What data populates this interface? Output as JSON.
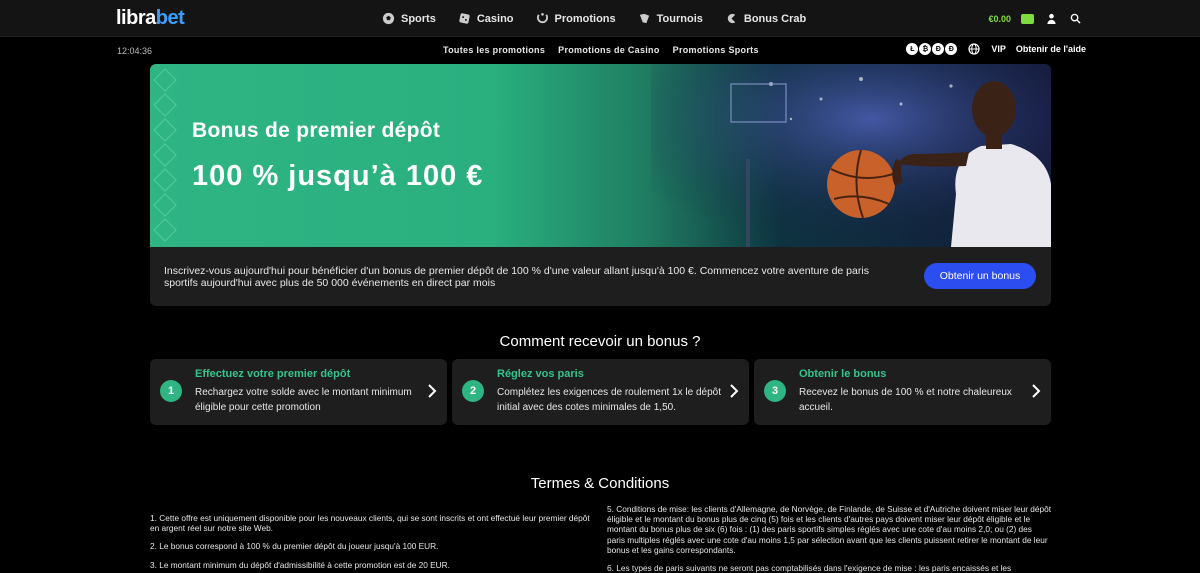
{
  "header": {
    "logo_main": "libra",
    "logo_accent": "bet",
    "nav": [
      {
        "label": "Sports",
        "icon": "soccer-ball-icon"
      },
      {
        "label": "Casino",
        "icon": "dice-icon"
      },
      {
        "label": "Promotions",
        "icon": "gift-icon"
      },
      {
        "label": "Tournois",
        "icon": "trophy-icon"
      },
      {
        "label": "Bonus Crab",
        "icon": "crab-icon"
      }
    ],
    "balance": "€0.00"
  },
  "subbar": {
    "clock": "12:04:36",
    "links": [
      "Toutes les promotions",
      "Promotions de Casino",
      "Promotions Sports"
    ],
    "coins": [
      "Ł",
      "₿",
      "Đ",
      "Ð"
    ],
    "vip": "VIP",
    "help": "Obtenir de l'aide"
  },
  "hero": {
    "title": "Bonus de premier dépôt",
    "subtitle": "100 % jusqu’à 100 €"
  },
  "info": {
    "text": "Inscrivez-vous aujourd'hui pour bénéficier d'un bonus de premier dépôt de 100 % d'une valeur allant jusqu'à 100 €. Commencez votre aventure de paris sportifs aujourd'hui avec plus de 50 000 événements en direct par mois",
    "cta": "Obtenir un bonus"
  },
  "how": {
    "title": "Comment recevoir un bonus ?",
    "steps": [
      {
        "num": "1",
        "title": "Effectuez votre premier dépôt",
        "desc": "Rechargez votre solde avec le montant minimum éligible pour cette promotion"
      },
      {
        "num": "2",
        "title": "Réglez vos paris",
        "desc": "Complétez les exigences de roulement 1x le dépôt initial avec des cotes minimales de 1,50."
      },
      {
        "num": "3",
        "title": "Obtenir le bonus",
        "desc": "Recevez le bonus de 100 % et notre chaleureux accueil."
      }
    ]
  },
  "terms": {
    "title": "Termes & Conditions",
    "left": [
      "1. Cette offre est uniquement disponible pour les nouveaux clients, qui se sont inscrits et ont effectué leur premier dépôt en argent réel sur notre site Web.",
      "2. Le bonus correspond à 100 % du premier dépôt du joueur jusqu'à 100 EUR.",
      "3. Le montant minimum du dépôt d'admissibilité à cette promotion est de 20 EUR."
    ],
    "right": [
      "5. Conditions de mise: les clients d'Allemagne, de Norvège, de Finlande, de Suisse et d'Autriche doivent miser leur dépôt éligible et le montant du bonus plus de cinq (5) fois et les clients d'autres pays doivent miser leur dépôt éligible et le montant du bonus plus de six (6) fois : (1) des paris sportifs simples réglés avec une cote d'au moins 2,0; ou (2) des paris multiples réglés avec une cote d'au moins 1,5 par sélection avant que les clients puissent retirer le montant de leur bonus et les gains correspondants.",
      "6. Les types de paris suivants ne seront pas comptabilisés dans l'exigence de mise : les paris encaissés et les"
    ]
  },
  "colors": {
    "accent_green": "#2fb584",
    "cta_blue": "#2c4ef0",
    "balance_green": "#7fdc3f"
  }
}
